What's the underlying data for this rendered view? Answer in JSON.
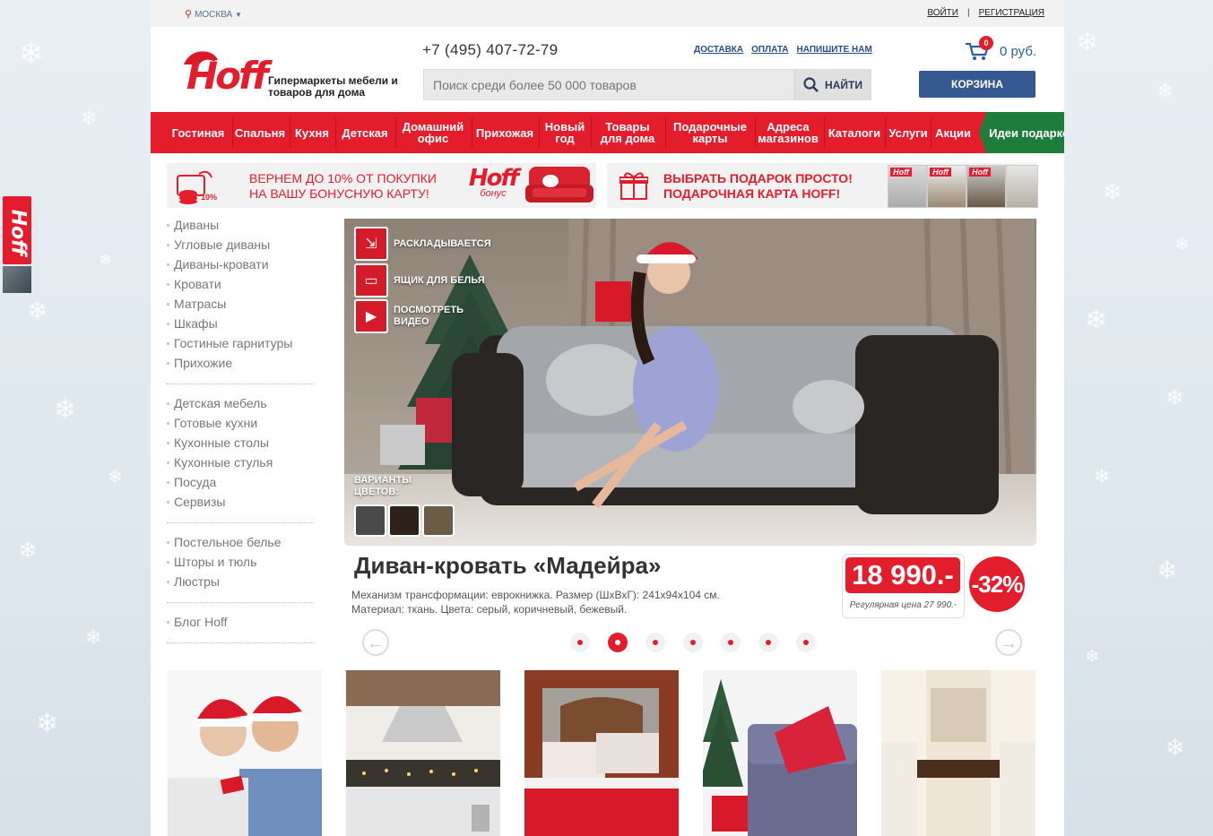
{
  "header": {
    "city": "МОСКВА",
    "login": "ВОЙТИ",
    "register": "РЕГИСТРАЦИЯ",
    "logo_text": "Hoff",
    "tagline": "Гипермаркеты мебели и товаров для дома",
    "phone": "+7 (495) 407-72-79",
    "links": [
      "ДОСТАВКА",
      "ОПЛАТА",
      "НАПИШИТЕ НАМ"
    ],
    "search_placeholder": "Поиск среди более 50 000 товаров",
    "search_button": "НАЙТИ",
    "cart_count": "0",
    "cart_sum": "0 руб.",
    "cart_button": "КОРЗИНА"
  },
  "nav": {
    "items": [
      "Гостиная",
      "Спальня",
      "Кухня",
      "Детская",
      "Домашний офис",
      "Прихожая",
      "Новый год",
      "Товары для дома",
      "Подарочные карты",
      "Адреса магазинов",
      "Каталоги",
      "Услуги",
      "Акции"
    ],
    "gift_ideas": "Идеи подарков"
  },
  "promos": {
    "bonus_text": "ВЕРНЕМ ДО 10% ОТ ПОКУПКИ НА ВАШУ БОНУСНУЮ КАРТУ!",
    "bonus_icon_label": "10%",
    "bonus_brand": "Hoff",
    "bonus_brand_sub": "бонус",
    "gift_text": "ВЫБРАТЬ ПОДАРОК ПРОСТО! ПОДАРОЧНАЯ КАРТА HOFF!",
    "gift_card_label": "Hoff"
  },
  "left_menu": {
    "group1": [
      "Диваны",
      "Угловые диваны",
      "Диваны-кровати",
      "Кровати",
      "Матрасы",
      "Шкафы",
      "Гостиные гарнитуры",
      "Прихожие"
    ],
    "group2": [
      "Детская мебель",
      "Готовые кухни",
      "Кухонные столы",
      "Кухонные стулья",
      "Посуда",
      "Сервизы"
    ],
    "group3": [
      "Постельное белье",
      "Шторы и тюль",
      "Люстры"
    ],
    "group4": [
      "Блог Hoff"
    ]
  },
  "hero": {
    "features": [
      "РАСКЛАДЫВАЕТСЯ",
      "ЯЩИК ДЛЯ БЕЛЬЯ",
      "ПОСМОТРЕТЬ ВИДЕО"
    ],
    "variants_label": "ВАРИАНТЫ ЦВЕТОВ:",
    "swatch_colors": [
      "#4a4a4a",
      "#2e211a",
      "#6b5c45"
    ],
    "title": "Диван-кровать «Мадейра»",
    "desc_line1": "Механизм трансформации: еврокнижка. Размер (ШхВхГ): 241х94х104 см.",
    "desc_line2": "Материал: ткань. Цвета: серый, коричневый, бежевый.",
    "price": "18 990.-",
    "old_price": "Регулярная цена 27 990.-",
    "discount": "-32%",
    "slide_count": 7,
    "active_slide": 2
  },
  "side_widget": {
    "logo_text": "Hoff"
  },
  "colors": {
    "brand_red": "#e41d2d",
    "nav_green": "#1e7d3b",
    "cart_blue": "#34588f"
  }
}
